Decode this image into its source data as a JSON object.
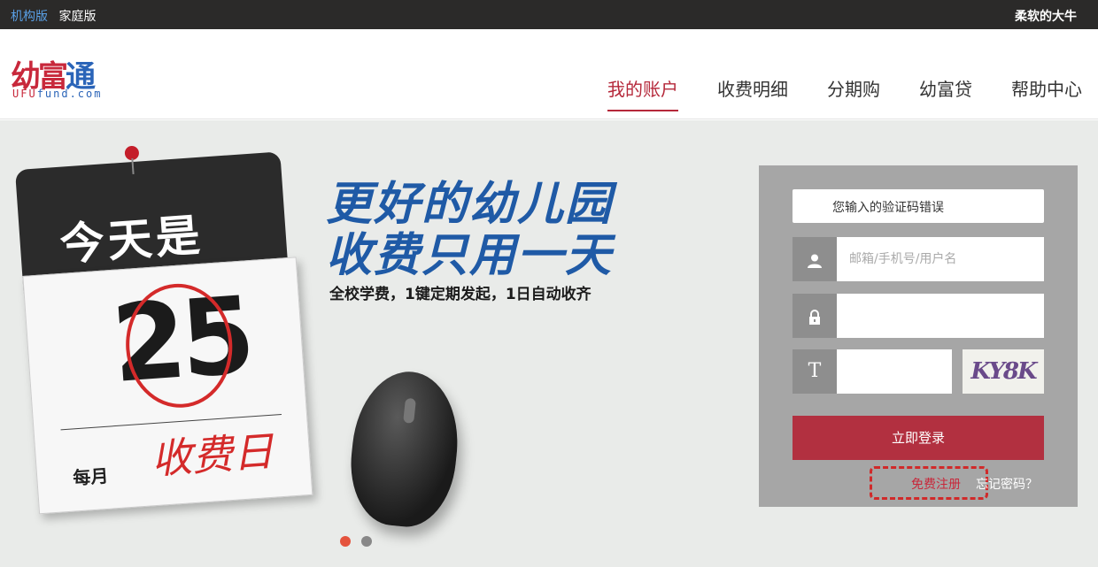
{
  "topbar": {
    "left_items": [
      "机构版",
      "家庭版"
    ],
    "user_name": "柔软的大牛"
  },
  "logo": {
    "main_red": "幼富",
    "main_blue": "通",
    "sub_red": "UFU",
    "sub_blue": "fund.com"
  },
  "nav": {
    "items": [
      "我的账户",
      "收费明细",
      "分期购",
      "幼富贷",
      "帮助中心"
    ],
    "active_index": 0
  },
  "banner": {
    "calendar_top": "今天是",
    "calendar_day": "25",
    "calendar_month_label": "每月",
    "calendar_handwriting": "收费日",
    "slogan_line1": "更好的幼儿园",
    "slogan_line2": "收费只用一天",
    "slogan_sub": "全校学费，1键定期发起，1日自动收齐",
    "carousel_active": 0,
    "carousel_count": 2
  },
  "login": {
    "error_message": "您输入的验证码错误",
    "username_placeholder": "邮箱/手机号/用户名",
    "password_value": "",
    "captcha_value": "",
    "captcha_text": "KY8K",
    "login_button": "立即登录",
    "register_link": "免费注册",
    "forgot_link": "忘记密码？"
  },
  "colors": {
    "accent_red": "#b23040",
    "brand_blue": "#1f5aa6",
    "topbar_bg": "#2b2a29",
    "panel_bg": "#a6a6a6"
  },
  "icons": {
    "user": "user-icon",
    "lock": "lock-icon",
    "captcha": "text-t-icon"
  }
}
